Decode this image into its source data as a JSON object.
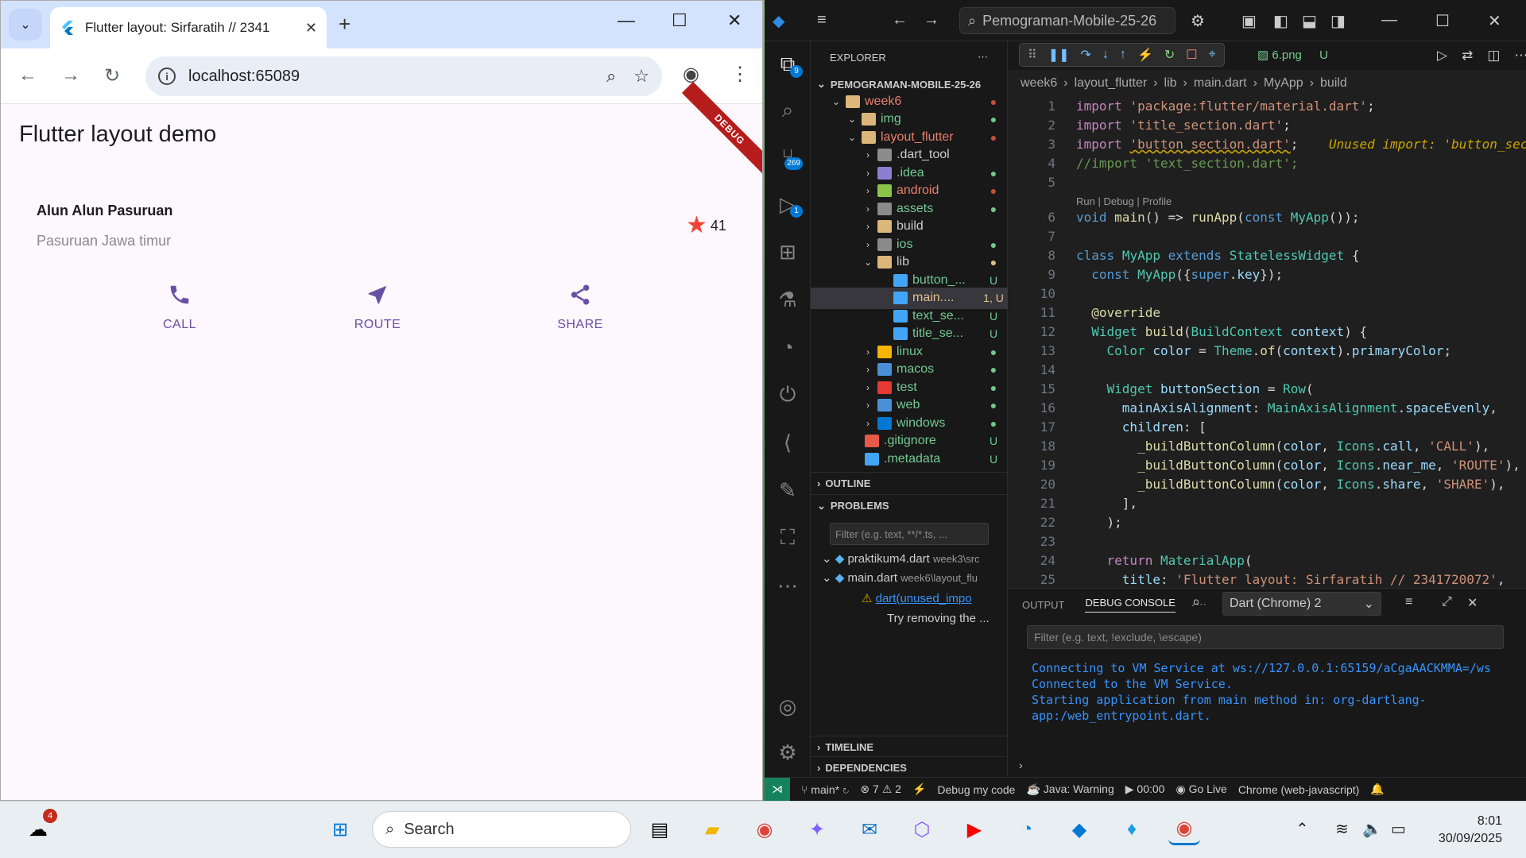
{
  "browser": {
    "tab_title": "Flutter layout: Sirfaratih // 2341",
    "url": "localhost:65089"
  },
  "app": {
    "appbar_title": "Flutter layout demo",
    "debug_banner": "DEBUG",
    "location_title": "Alun Alun Pasuruan",
    "location_subtitle": "Pasuruan Jawa timur",
    "rating": "41",
    "buttons": [
      {
        "label": "CALL",
        "icon": "phone-icon"
      },
      {
        "label": "ROUTE",
        "icon": "near-me-icon"
      },
      {
        "label": "SHARE",
        "icon": "share-icon"
      }
    ],
    "accent_color": "#6750a4",
    "star_color": "#f44336"
  },
  "vscode": {
    "search_text": "Pemograman-Mobile-25-26",
    "explorer_label": "EXPLORER",
    "workspace": "PEMOGRAMAN-MOBILE-25-26",
    "activity_badges": {
      "explorer": "9",
      "scm": "269",
      "debug": "1"
    },
    "tree": [
      {
        "name": "week6",
        "status": "●",
        "status_color": "red"
      },
      {
        "name": "img",
        "status": "●",
        "status_color": "green"
      },
      {
        "name": "layout_flutter",
        "status": "●",
        "status_color": "red"
      },
      {
        "name": ".dart_tool",
        "status": "",
        "status_color": ""
      },
      {
        "name": ".idea",
        "status": "●",
        "status_color": "green"
      },
      {
        "name": "android",
        "status": "●",
        "status_color": "red"
      },
      {
        "name": "assets",
        "status": "●",
        "status_color": "green"
      },
      {
        "name": "build",
        "status": "",
        "status_color": ""
      },
      {
        "name": "ios",
        "status": "●",
        "status_color": "green"
      },
      {
        "name": "lib",
        "status": "●",
        "status_color": "yellow"
      },
      {
        "name": "button_...",
        "status": "U",
        "status_color": "green"
      },
      {
        "name": "main....",
        "status": "1, U",
        "status_color": "yellow"
      },
      {
        "name": "text_se...",
        "status": "U",
        "status_color": "green"
      },
      {
        "name": "title_se...",
        "status": "U",
        "status_color": "green"
      },
      {
        "name": "linux",
        "status": "●",
        "status_color": "green"
      },
      {
        "name": "macos",
        "status": "●",
        "status_color": "green"
      },
      {
        "name": "test",
        "status": "●",
        "status_color": "green"
      },
      {
        "name": "web",
        "status": "●",
        "status_color": "green"
      },
      {
        "name": "windows",
        "status": "●",
        "status_color": "green"
      },
      {
        "name": ".gitignore",
        "status": "U",
        "status_color": "green"
      },
      {
        "name": ".metadata",
        "status": "U",
        "status_color": "green"
      }
    ],
    "sections": {
      "outline": "OUTLINE",
      "problems": "PROBLEMS",
      "timeline": "TIMELINE",
      "dependencies": "DEPENDENCIES"
    },
    "problems_filter": "Filter (e.g. text, **/*.ts, ...",
    "problems": [
      {
        "file": "praktikum4.dart",
        "path": "week3\\src"
      },
      {
        "file": "main.dart",
        "path": "week6\\layout_flu"
      }
    ],
    "problem_detail": "dart(unused_impo",
    "problem_hint": "Try removing the ...",
    "editor_tab": "6.png",
    "editor_tab_status": "U",
    "breadcrumb": [
      "week6",
      "layout_flutter",
      "lib",
      "main.dart",
      "MyApp",
      "build"
    ],
    "codelens": "Run | Debug | Profile",
    "inline_warning": "Unused import: 'button_sec",
    "code_lines": [
      "import 'package:flutter/material.dart';",
      "import 'title_section.dart';",
      "import 'button_section.dart';",
      "//import 'text_section.dart';",
      "",
      "void main() => runApp(const MyApp());",
      "",
      "class MyApp extends StatelessWidget {",
      "  const MyApp({super.key});",
      "",
      "  @override",
      "  Widget build(BuildContext context) {",
      "    Color color = Theme.of(context).primaryColor;",
      "",
      "    Widget buttonSection = Row(",
      "      mainAxisAlignment: MainAxisAlignment.spaceEvenly,",
      "      children: [",
      "        _buildButtonColumn(color, Icons.call, 'CALL'),",
      "        _buildButtonColumn(color, Icons.near_me, 'ROUTE'),",
      "        _buildButtonColumn(color, Icons.share, 'SHARE'),",
      "      ],",
      "    );",
      "",
      "    return MaterialApp(",
      "      title: 'Flutter layout: Sirfaratih // 2341720072',"
    ],
    "panel": {
      "output_tab": "OUTPUT",
      "debug_console_tab": "DEBUG CONSOLE",
      "selected_session": "Dart (Chrome) 2",
      "filter_placeholder": "Filter (e.g. text, !exclude, \\escape)",
      "console_text": "Connecting to VM Service at ws://127.0.0.1:65159/aCgaAACKMMA=/ws\nConnected to the VM Service.\nStarting application from main method in: org-dartlang-app:/web_entrypoint.dart."
    },
    "status": {
      "branch": "main*",
      "errors": "7",
      "warnings": "2",
      "debug_my_code": "Debug my code",
      "java": "Java: Warning",
      "timer": "00:00",
      "golive": "Go Live",
      "target": "Chrome (web-javascript)"
    }
  },
  "taskbar": {
    "search_label": "Search",
    "weather_badge": "4",
    "time": "8:01",
    "date": "30/09/2025"
  }
}
